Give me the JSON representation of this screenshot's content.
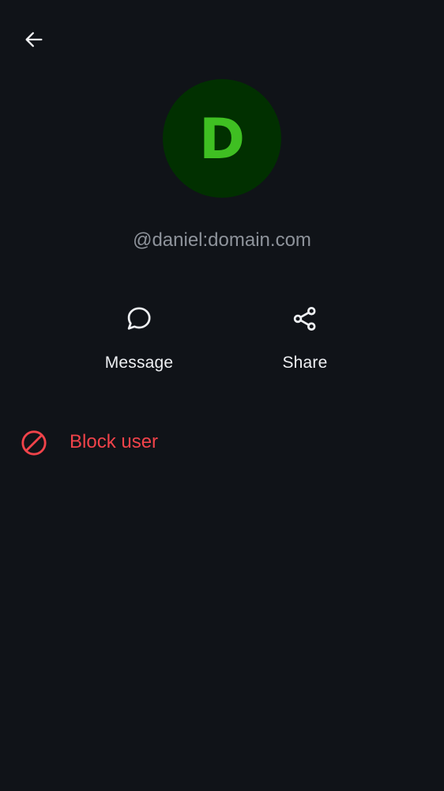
{
  "header": {
    "back_icon": "arrow-left-icon"
  },
  "profile": {
    "avatar_letter": "D",
    "user_id": "@daniel:domain.com",
    "avatar_bg_color": "#013000",
    "avatar_letter_color": "#3fbf22"
  },
  "actions": [
    {
      "label": "Message",
      "icon": "chat-bubble-icon"
    },
    {
      "label": "Share",
      "icon": "share-icon"
    }
  ],
  "block": {
    "label": "Block user",
    "icon": "block-icon",
    "color": "#f2434a"
  },
  "theme": {
    "background": "#101318"
  }
}
